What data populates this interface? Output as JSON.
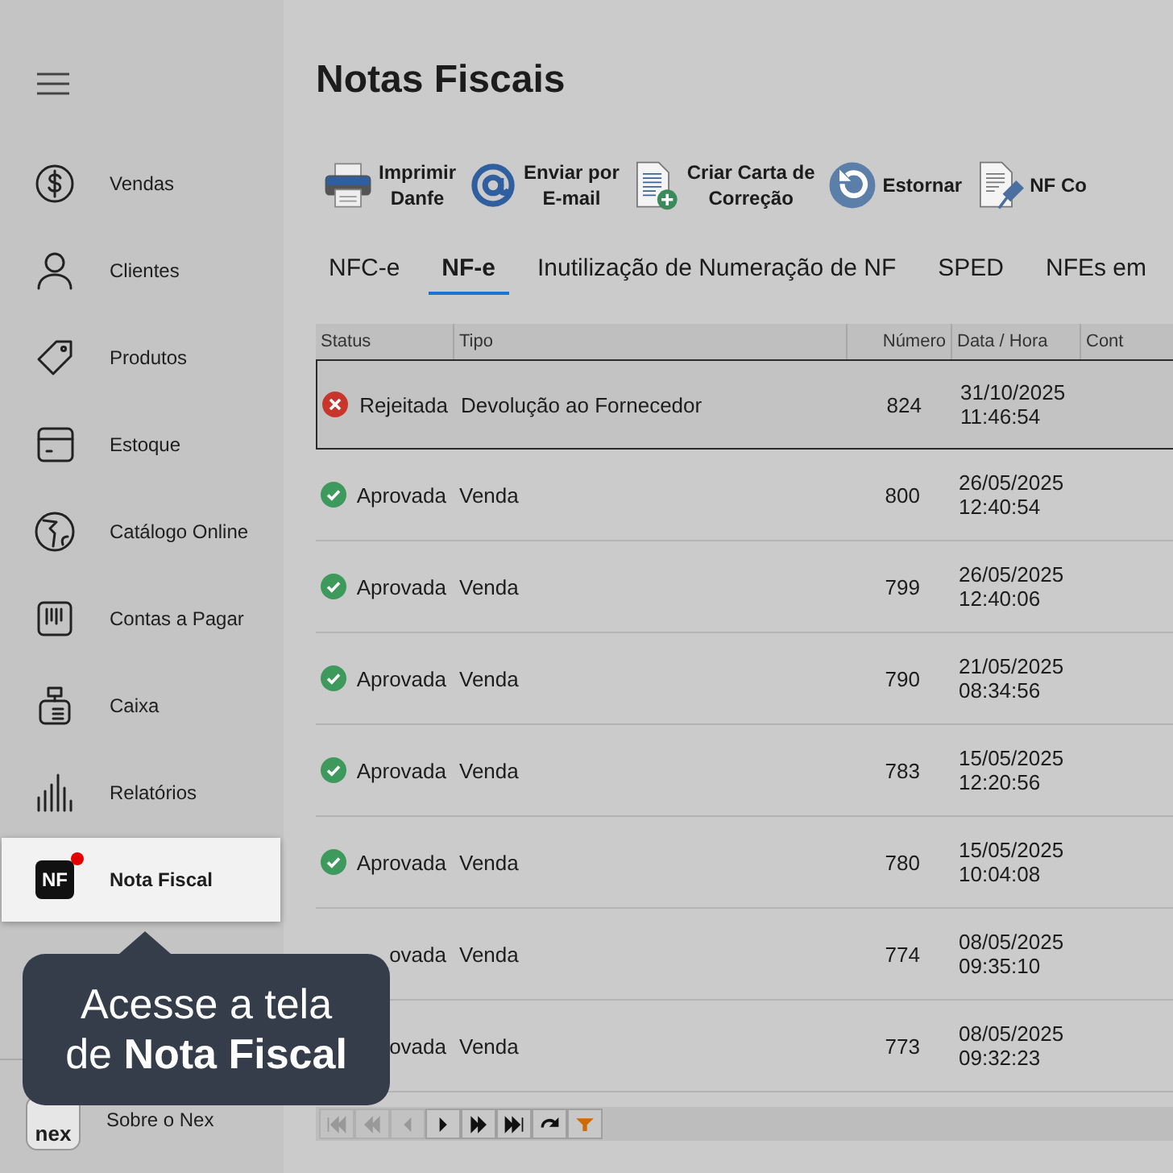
{
  "sidebar": {
    "items": [
      {
        "label": "Vendas",
        "selected": false,
        "notification": false
      },
      {
        "label": "Clientes",
        "selected": false,
        "notification": false
      },
      {
        "label": "Produtos",
        "selected": false,
        "notification": false
      },
      {
        "label": "Estoque",
        "selected": false,
        "notification": false
      },
      {
        "label": "Catálogo Online",
        "selected": false,
        "notification": false
      },
      {
        "label": "Contas a Pagar",
        "selected": false,
        "notification": false
      },
      {
        "label": "Caixa",
        "selected": false,
        "notification": false
      },
      {
        "label": "Relatórios",
        "selected": false,
        "notification": false
      },
      {
        "icon_text": "NF",
        "label": "Nota Fiscal",
        "selected": true,
        "notification": true
      }
    ],
    "footer": {
      "logo": "nex",
      "label": "Sobre o Nex"
    }
  },
  "page": {
    "title": "Notas Fiscais",
    "toolbar": [
      {
        "label": "Imprimir\nDanfe"
      },
      {
        "label": "Enviar por\nE-mail"
      },
      {
        "label": "Criar Carta de\nCorreção"
      },
      {
        "label": "Estornar"
      },
      {
        "label": "NF Co"
      }
    ],
    "tabs": [
      {
        "label": "NFC-e",
        "selected": false
      },
      {
        "label": "NF-e",
        "selected": true
      },
      {
        "label": "Inutilização de Numeração de NF",
        "selected": false
      },
      {
        "label": "SPED",
        "selected": false
      },
      {
        "label": "NFEs em",
        "selected": false
      }
    ],
    "table": {
      "columns": [
        "Status",
        "Tipo",
        "Número",
        "Data / Hora",
        "Cont"
      ],
      "rows": [
        {
          "kind": "rejected",
          "status": "Rejeitada",
          "tipo": "Devolução ao Fornecedor",
          "numero": "824",
          "data_hora": "31/10/2025\n11:46:54",
          "selected": true
        },
        {
          "kind": "approved",
          "status": "Aprovada",
          "tipo": "Venda",
          "numero": "800",
          "data_hora": "26/05/2025\n12:40:54",
          "selected": false
        },
        {
          "kind": "approved",
          "status": "Aprovada",
          "tipo": "Venda",
          "numero": "799",
          "data_hora": "26/05/2025\n12:40:06",
          "selected": false
        },
        {
          "kind": "approved",
          "status": "Aprovada",
          "tipo": "Venda",
          "numero": "790",
          "data_hora": "21/05/2025\n08:34:56",
          "selected": false
        },
        {
          "kind": "approved",
          "status": "Aprovada",
          "tipo": "Venda",
          "numero": "783",
          "data_hora": "15/05/2025\n12:20:56",
          "selected": false
        },
        {
          "kind": "approved",
          "status": "Aprovada",
          "tipo": "Venda",
          "numero": "780",
          "data_hora": "15/05/2025\n10:04:08",
          "selected": false
        },
        {
          "status": "ovada",
          "tipo": "Venda",
          "numero": "774",
          "data_hora": "08/05/2025\n09:35:10",
          "selected": false
        },
        {
          "status": "ovada",
          "tipo": "Venda",
          "numero": "773",
          "data_hora": "08/05/2025\n09:32:23",
          "selected": false
        }
      ]
    },
    "pager": [
      {
        "kind": "first",
        "disabled": true
      },
      {
        "kind": "prev-page",
        "disabled": true
      },
      {
        "kind": "prev",
        "disabled": true
      },
      {
        "kind": "next",
        "disabled": false
      },
      {
        "kind": "next-page",
        "disabled": false
      },
      {
        "kind": "last",
        "disabled": false
      },
      {
        "kind": "refresh",
        "disabled": false
      },
      {
        "kind": "filter",
        "disabled": false
      }
    ]
  },
  "tooltip": {
    "text": "Acesse a tela\nde **Nota Fiscal**"
  }
}
